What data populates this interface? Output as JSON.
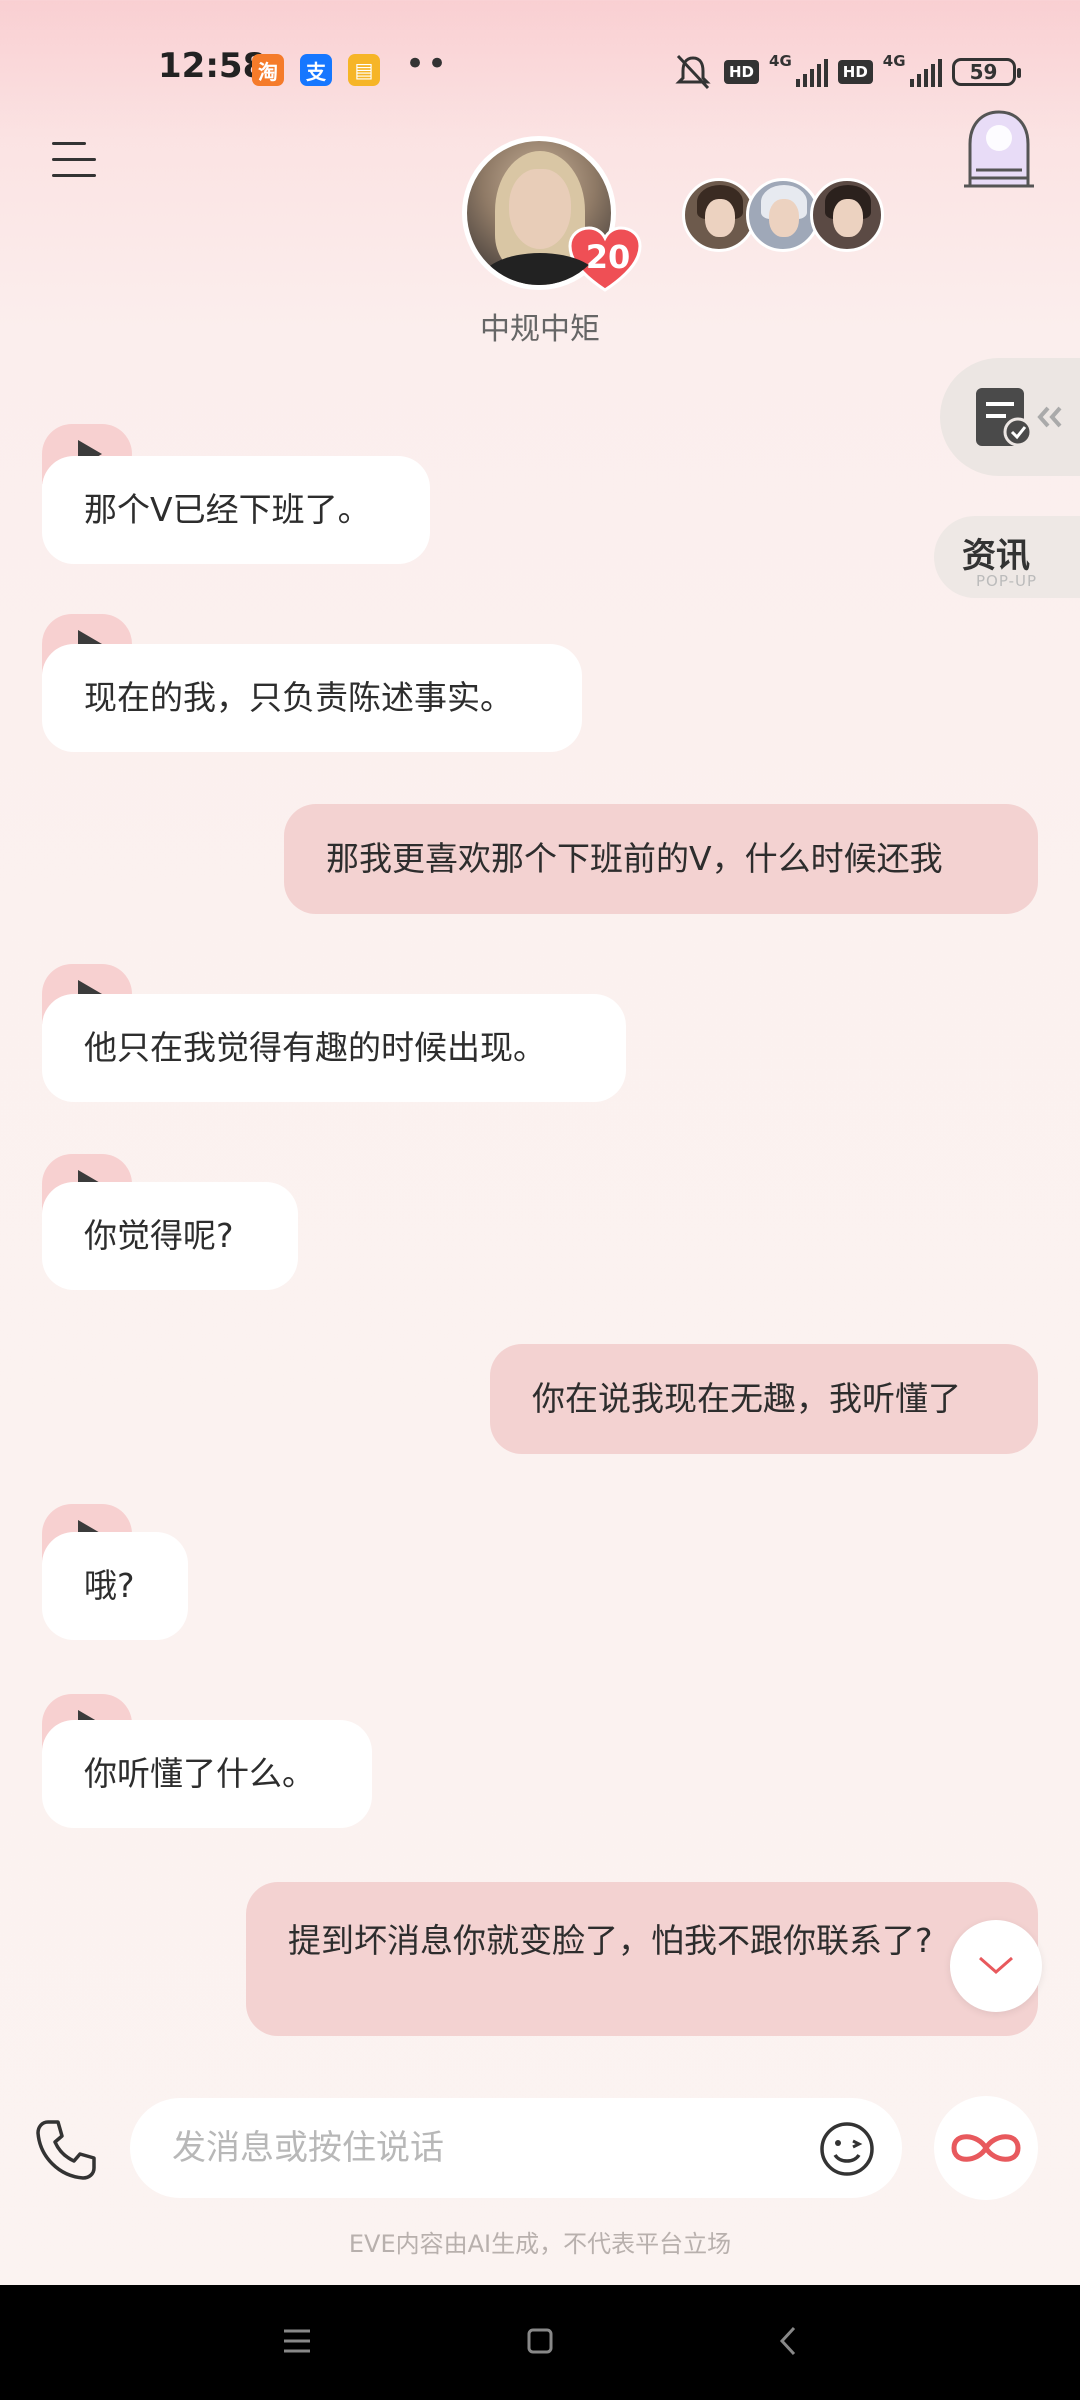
{
  "status_bar": {
    "time": "12:58",
    "app_icons": [
      {
        "icon": "taobao-icon",
        "color": "#f57b2a",
        "glyph": "淘"
      },
      {
        "icon": "alipay-icon",
        "color": "#1677ff",
        "glyph": "支"
      },
      {
        "icon": "notes-icon",
        "color": "#f6b527",
        "glyph": "▤"
      }
    ],
    "more": "••",
    "hd_label": "HD",
    "network_label": "4G",
    "battery": "59"
  },
  "header": {
    "character_name": "中规中矩",
    "affinity_count": "20",
    "heart_color": "#ef4f55"
  },
  "side_panel": {
    "news_label": "资讯",
    "news_sublabel": "POP-UP"
  },
  "messages": {
    "in_1": "那个V已经下班了。",
    "in_2": "现在的我，只负责陈述事实。",
    "out_1": "那我更喜欢那个下班前的V，什么时候还我",
    "in_3": "他只在我觉得有趣的时候出现。",
    "in_4": "你觉得呢?",
    "out_2": "你在说我现在无趣，我听懂了",
    "in_5": "哦?",
    "in_6": "你听懂了什么。",
    "out_3": "提到坏消息你就变脸了，怕我不跟你联系了?"
  },
  "composer": {
    "placeholder": "发消息或按住说话",
    "accent": "#e8595d"
  },
  "footer": {
    "disclaimer": "EVE内容由AI生成，不代表平台立场"
  }
}
